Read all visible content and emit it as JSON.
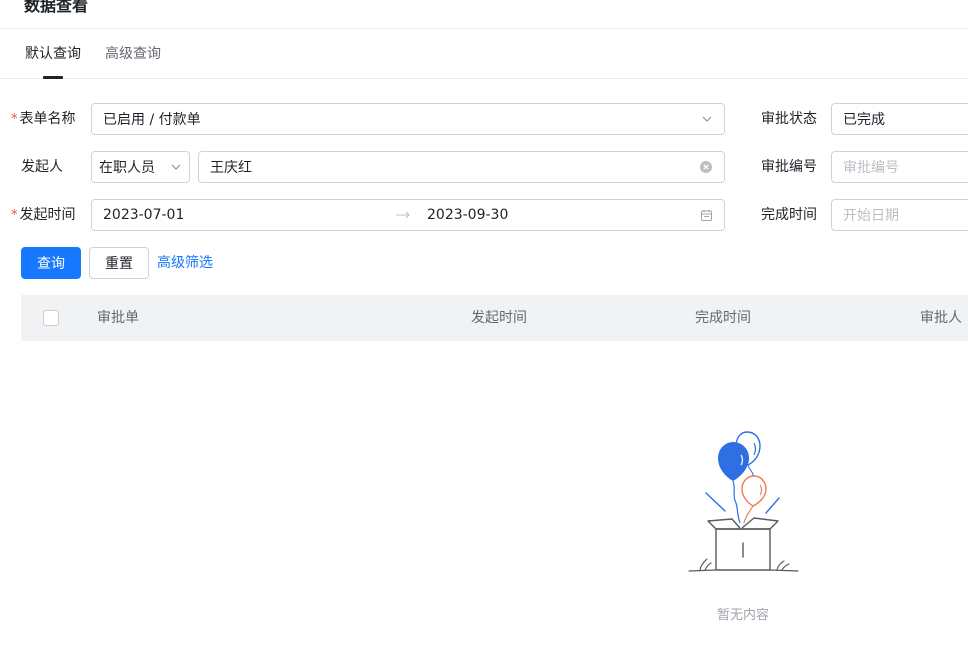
{
  "page": {
    "title": "数据查看"
  },
  "tabs": [
    {
      "label": "默认查询",
      "active": true
    },
    {
      "label": "高级查询",
      "active": false
    }
  ],
  "form": {
    "form_name": {
      "label": "表单名称",
      "required": true,
      "value": "已启用 / 付款单"
    },
    "approval_status": {
      "label": "审批状态",
      "value": "已完成"
    },
    "initiator": {
      "label": "发起人",
      "type_value": "在职人员",
      "value": "王庆红"
    },
    "approval_no": {
      "label": "审批编号",
      "placeholder": "审批编号"
    },
    "start_time": {
      "label": "发起时间",
      "required": true,
      "start": "2023-07-01",
      "end": "2023-09-30"
    },
    "finish_time": {
      "label": "完成时间",
      "placeholder": "开始日期"
    }
  },
  "actions": {
    "query": "查询",
    "reset": "重置",
    "advanced_filter": "高级筛选"
  },
  "table": {
    "columns": [
      "审批单",
      "发起时间",
      "完成时间",
      "审批人"
    ]
  },
  "empty": {
    "text": "暂无内容"
  },
  "colors": {
    "primary": "#1677ff",
    "required": "#f54a45",
    "balloon_blue": "#2f6fe4",
    "balloon_orange": "#f07a52"
  }
}
